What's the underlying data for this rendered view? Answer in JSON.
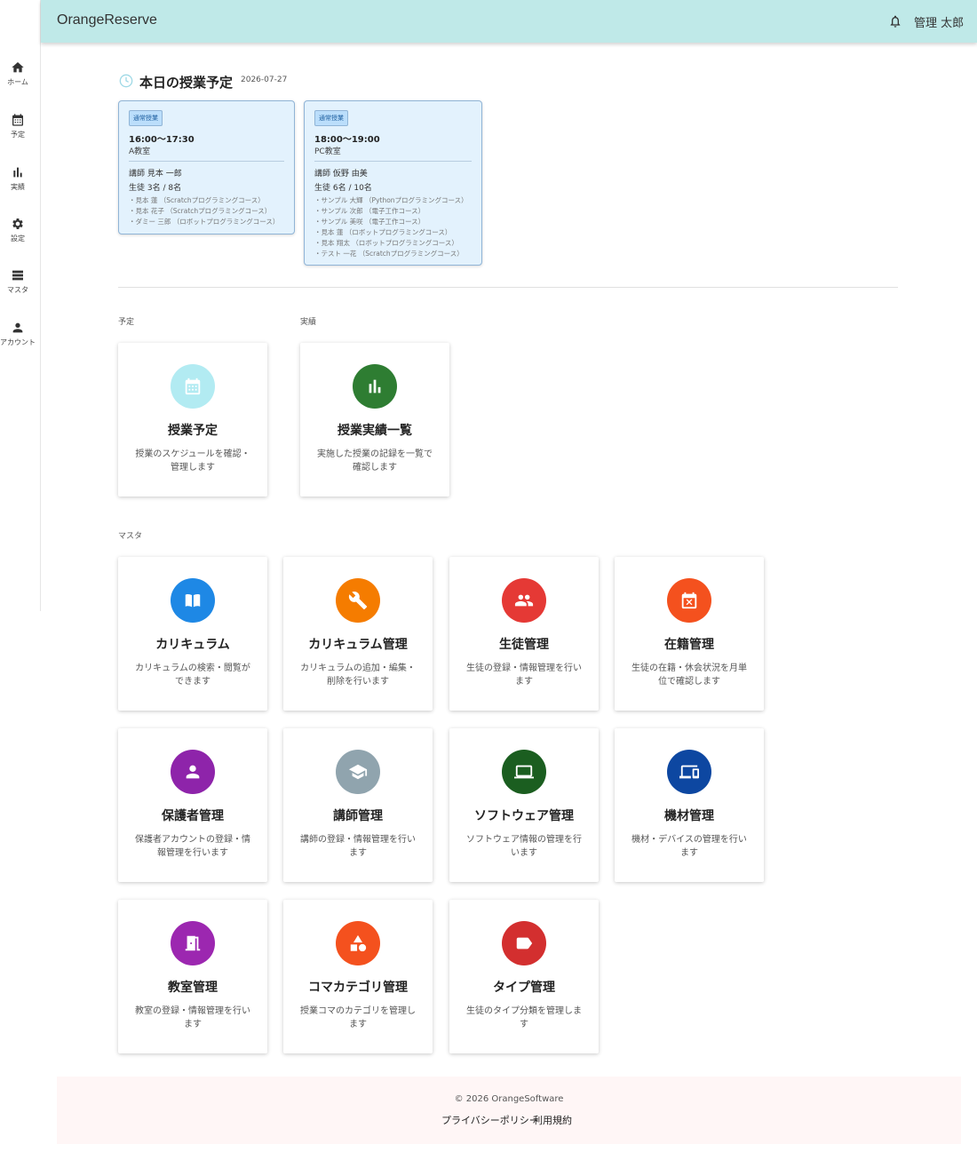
{
  "app": {
    "title": "OrangeReserve"
  },
  "header": {
    "user_name": "管理 太郎"
  },
  "sidebar": {
    "items": [
      {
        "label": "ホーム",
        "icon": "home-icon"
      },
      {
        "label": "予定",
        "icon": "calendar-icon"
      },
      {
        "label": "実績",
        "icon": "bar-chart-icon"
      },
      {
        "label": "設定",
        "icon": "gear-icon"
      },
      {
        "label": "マスタ",
        "icon": "list-icon"
      },
      {
        "label": "アカウント",
        "icon": "person-icon"
      }
    ]
  },
  "schedule": {
    "title": "本日の授業予定",
    "date": "2026-07-27",
    "lessons": [
      {
        "badge": "通常授業",
        "time": "16:00〜17:30",
        "room": "A教室",
        "teacher": "講師 見本 一郎",
        "count": "生徒 3名 / 8名",
        "students": [
          "・見本 蓮 （Scratchプログラミングコース）",
          "・見本 花子 （Scratchプログラミングコース）",
          "・ダミー 三郎 （ロボットプログラミングコース）"
        ]
      },
      {
        "badge": "通常授業",
        "time": "18:00〜19:00",
        "room": "PC教室",
        "teacher": "講師 仮野 由美",
        "count": "生徒 6名 / 10名",
        "students": [
          "・サンプル 大輝 （Pythonプログラミングコース）",
          "・サンプル 次郎 （電子工作コース）",
          "・サンプル 美咲 （電子工作コース）",
          "・見本 蓮 （ロボットプログラミングコース）",
          "・見本 翔太 （ロボットプログラミングコース）",
          "・テスト 一花 （Scratchプログラミングコース）"
        ]
      }
    ]
  },
  "sections": {
    "yotei": "予定",
    "jisseki": "実績",
    "master": "マスタ"
  },
  "cards": [
    {
      "title": "授業予定",
      "desc": "授業のスケジュールを確認・管理します",
      "icon": "calendar-icon",
      "color": "#b2ebf2"
    },
    {
      "title": "授業実績一覧",
      "desc": "実施した授業の記録を一覧で確認します",
      "icon": "bar-chart-icon",
      "color": "#2e7d32"
    },
    {
      "title": "カリキュラム",
      "desc": "カリキュラムの検索・閲覧ができます",
      "icon": "book-icon",
      "color": "#1e88e5"
    },
    {
      "title": "カリキュラム管理",
      "desc": "カリキュラムの追加・編集・削除を行います",
      "icon": "wrench-icon",
      "color": "#f57c00"
    },
    {
      "title": "生徒管理",
      "desc": "生徒の登録・情報管理を行います",
      "icon": "people-icon",
      "color": "#e53935"
    },
    {
      "title": "在籍管理",
      "desc": "生徒の在籍・休会状況を月単位で確認します",
      "icon": "calendar-x-icon",
      "color": "#f4511e"
    },
    {
      "title": "保護者管理",
      "desc": "保護者アカウントの登録・情報管理を行います",
      "icon": "person-icon",
      "color": "#8e24aa"
    },
    {
      "title": "講師管理",
      "desc": "講師の登録・情報管理を行います",
      "icon": "graduation-cap-icon",
      "color": "#90a4ae"
    },
    {
      "title": "ソフトウェア管理",
      "desc": "ソフトウェア情報の管理を行います",
      "icon": "laptop-icon",
      "color": "#1b5e20"
    },
    {
      "title": "機材管理",
      "desc": "機材・デバイスの管理を行います",
      "icon": "devices-icon",
      "color": "#0d47a1"
    },
    {
      "title": "教室管理",
      "desc": "教室の登録・情報管理を行います",
      "icon": "door-icon",
      "color": "#9c27b0"
    },
    {
      "title": "コマカテゴリ管理",
      "desc": "授業コマのカテゴリを管理します",
      "icon": "shapes-icon",
      "color": "#f4511e"
    },
    {
      "title": "タイプ管理",
      "desc": "生徒のタイプ分類を管理します",
      "icon": "label-icon",
      "color": "#d32f2f"
    }
  ],
  "footer": {
    "copyright": "© 2026 OrangeSoftware",
    "privacy": "プライバシーポリシー",
    "terms": "利用規約"
  }
}
